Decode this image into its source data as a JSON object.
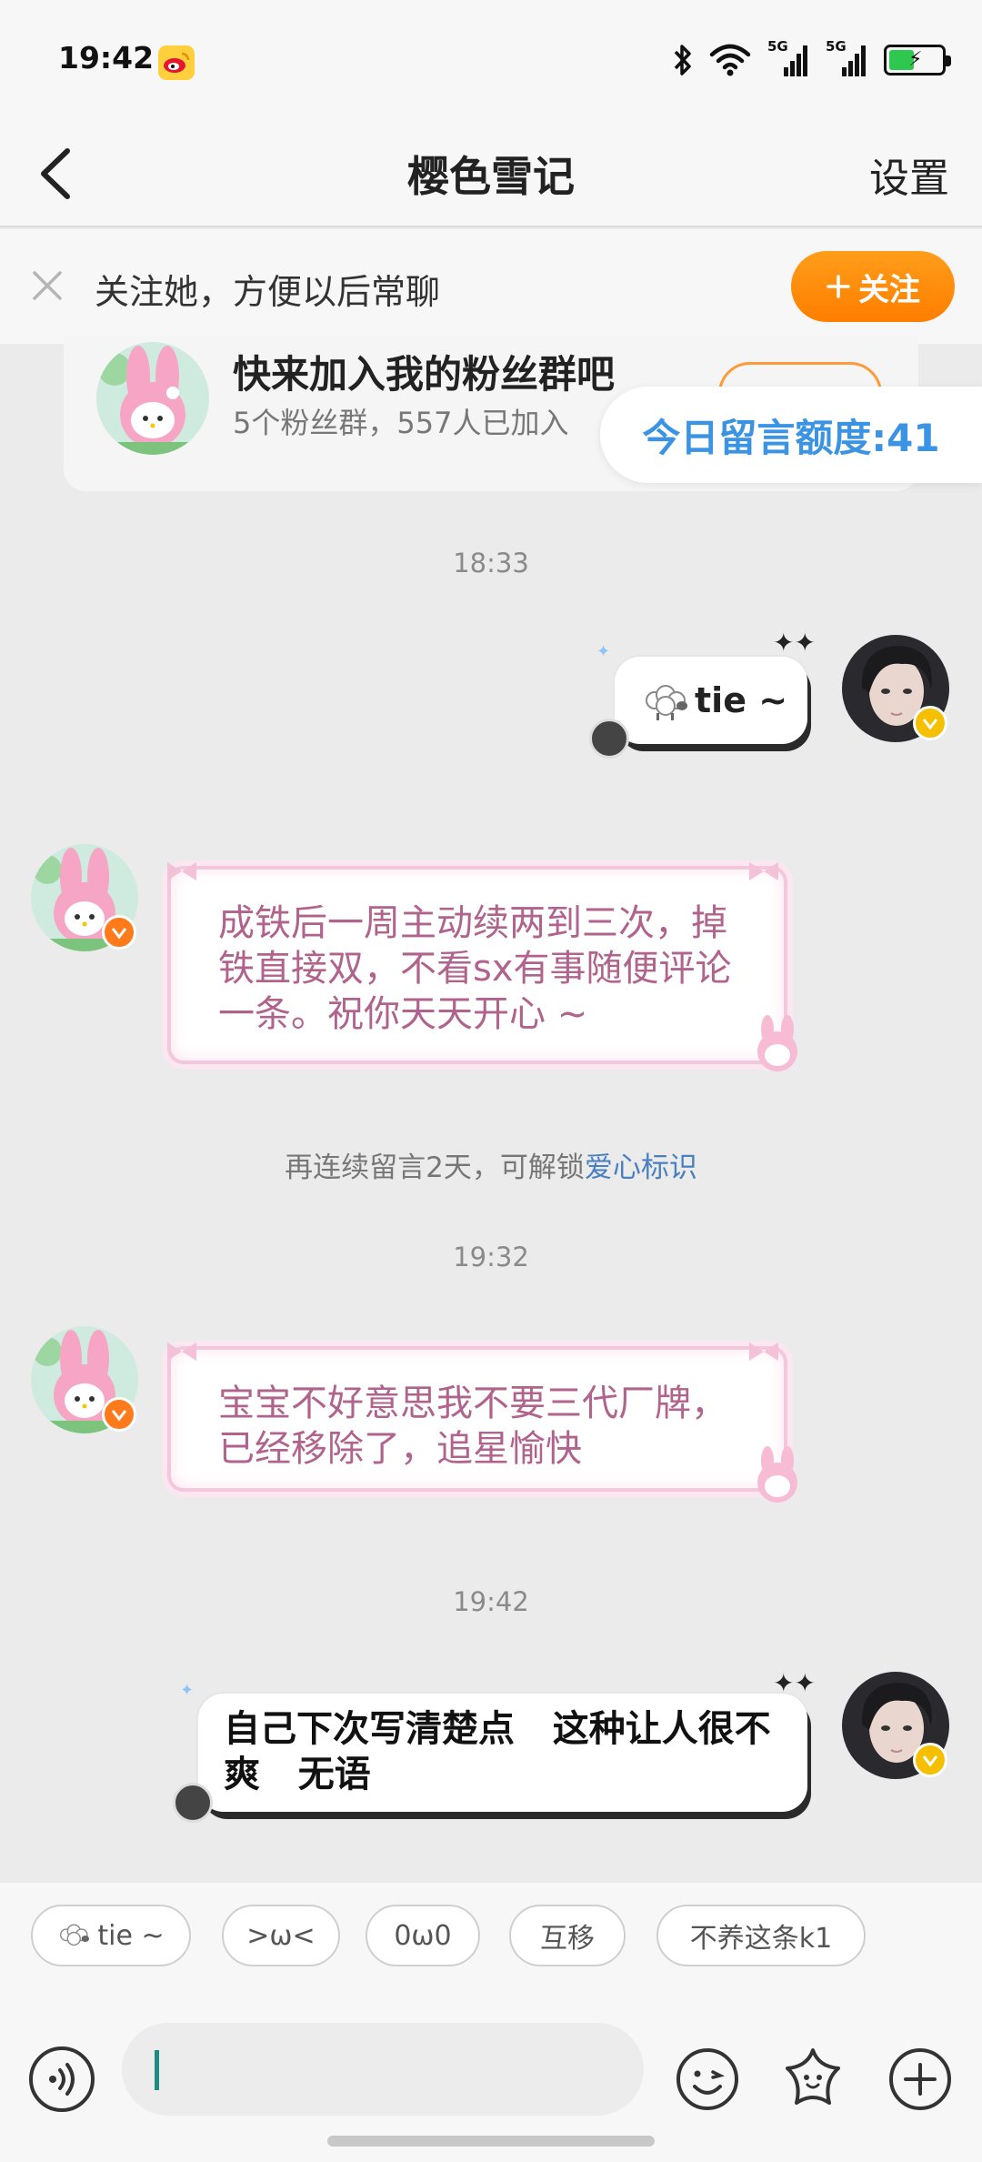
{
  "status_bar": {
    "time": "19:42",
    "network_1": "5G",
    "network_2": "5G"
  },
  "nav": {
    "title": "樱色雪记",
    "settings_label": "设置"
  },
  "follow_bar": {
    "text": "关注她，方便以后常聊",
    "follow_button": "关注"
  },
  "fan_group": {
    "title": "快来加入我的粉丝群吧",
    "subtitle": "5个粉丝群，557人已加入"
  },
  "quota": {
    "text": "今日留言额度:41"
  },
  "messages": [
    {
      "type": "timestamp",
      "text": "18:33"
    },
    {
      "type": "sent",
      "text": "tie ~"
    },
    {
      "type": "received",
      "text": "成铁后一周主动续两到三次，掉铁直接双，不看sx有事随便评论一条。祝你天天开心 ~"
    },
    {
      "type": "note",
      "text": "再连续留言2天，可解锁",
      "highlight": "爱心标识"
    },
    {
      "type": "timestamp",
      "text": "19:32"
    },
    {
      "type": "received",
      "text": "宝宝不好意思我不要三代厂牌，已经移除了，追星愉快"
    },
    {
      "type": "timestamp",
      "text": "19:42"
    },
    {
      "type": "sent",
      "text": "自己下次写清楚点   这种让人很不爽   无语"
    }
  ],
  "quick_replies": [
    "tie ~",
    ">ω<",
    "0ω0",
    "互移",
    "不养这条k1"
  ],
  "colors": {
    "accent_orange": "#ff8a0f",
    "link_blue": "#4a7fc0",
    "quota_blue": "#3b93e4",
    "pink_text": "#b0638c"
  }
}
